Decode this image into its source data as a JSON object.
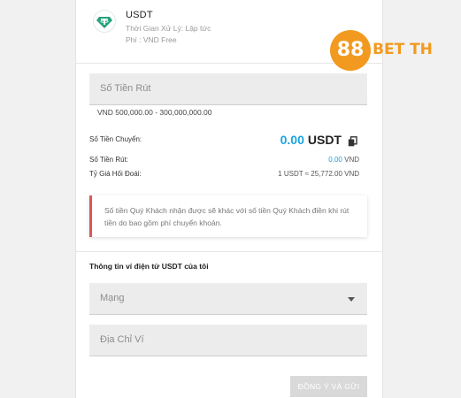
{
  "method": {
    "name": "USDT",
    "processing_time": "Thời Gian Xử Lý: Lập tức",
    "fee": "Phí : VND Free",
    "icon": "tether-icon"
  },
  "withdraw_amount": {
    "placeholder": "Số Tiền Rút",
    "range": "VND 500,000.00 - 300,000,000.00"
  },
  "summary": {
    "transfer_label": "Số Tiền Chuyển:",
    "transfer_value": "0.00",
    "transfer_currency": "USDT",
    "withdraw_label": "Số Tiền Rút:",
    "withdraw_value": "0.00",
    "withdraw_currency": "VND",
    "rate_label": "Tỷ Giá Hối Đoái:",
    "rate_value": "1 USDT ≈ 25,772.00 VND"
  },
  "notice": {
    "text": "Số tiền Quý Khách nhận được sẽ khác với số tiền Quý Khách điền khi rút tiền do bao gồm phí chuyển khoản."
  },
  "wallet": {
    "section_title": "Thông tin ví điện tử USDT của tôi",
    "network_placeholder": "Mạng",
    "address_placeholder": "Địa Chỉ Ví"
  },
  "submit_label": "ĐỒNG Ý VÀ GỬI",
  "brand": {
    "number": "88",
    "text": "BET TH"
  },
  "colors": {
    "accent": "#1ba3dd",
    "tether": "#26a17b",
    "notice_border": "#e05555",
    "brand": "#f29a1f"
  }
}
